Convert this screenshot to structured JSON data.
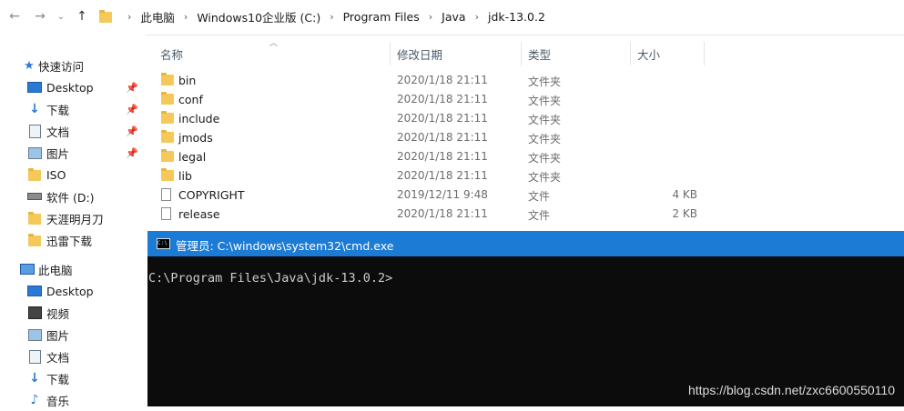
{
  "address": {
    "crumbs": [
      "此电脑",
      "Windows10企业版 (C:)",
      "Program Files",
      "Java",
      "jdk-13.0.2"
    ]
  },
  "sidebar": {
    "items": [
      {
        "label": "快速访问",
        "icon": "star-icon",
        "pinned": false
      },
      {
        "label": "Desktop",
        "icon": "desktop-icon",
        "pinned": true
      },
      {
        "label": "下载",
        "icon": "download-icon",
        "pinned": true
      },
      {
        "label": "文档",
        "icon": "document-icon",
        "pinned": true
      },
      {
        "label": "图片",
        "icon": "picture-icon",
        "pinned": true
      },
      {
        "label": "ISO",
        "icon": "folder-icon",
        "pinned": false
      },
      {
        "label": "软件 (D:)",
        "icon": "drive-icon",
        "pinned": false
      },
      {
        "label": "天涯明月刀",
        "icon": "folder-icon",
        "pinned": false
      },
      {
        "label": "迅雷下载",
        "icon": "folder-icon",
        "pinned": false
      },
      {
        "label": "此电脑",
        "icon": "computer-icon",
        "pinned": false
      },
      {
        "label": "Desktop",
        "icon": "desktop-icon",
        "pinned": false
      },
      {
        "label": "视频",
        "icon": "video-icon",
        "pinned": false
      },
      {
        "label": "图片",
        "icon": "picture-icon",
        "pinned": false
      },
      {
        "label": "文档",
        "icon": "document-icon",
        "pinned": false
      },
      {
        "label": "下载",
        "icon": "download-icon",
        "pinned": false
      },
      {
        "label": "音乐",
        "icon": "music-icon",
        "pinned": false
      }
    ]
  },
  "columns": {
    "name": "名称",
    "date": "修改日期",
    "type": "类型",
    "size": "大小"
  },
  "files": [
    {
      "name": "bin",
      "date": "2020/1/18 21:11",
      "type": "文件夹",
      "size": "",
      "kind": "folder"
    },
    {
      "name": "conf",
      "date": "2020/1/18 21:11",
      "type": "文件夹",
      "size": "",
      "kind": "folder"
    },
    {
      "name": "include",
      "date": "2020/1/18 21:11",
      "type": "文件夹",
      "size": "",
      "kind": "folder"
    },
    {
      "name": "jmods",
      "date": "2020/1/18 21:11",
      "type": "文件夹",
      "size": "",
      "kind": "folder"
    },
    {
      "name": "legal",
      "date": "2020/1/18 21:11",
      "type": "文件夹",
      "size": "",
      "kind": "folder"
    },
    {
      "name": "lib",
      "date": "2020/1/18 21:11",
      "type": "文件夹",
      "size": "",
      "kind": "folder"
    },
    {
      "name": "COPYRIGHT",
      "date": "2019/12/11 9:48",
      "type": "文件",
      "size": "4 KB",
      "kind": "file"
    },
    {
      "name": "release",
      "date": "2020/1/18 21:11",
      "type": "文件",
      "size": "2 KB",
      "kind": "file"
    }
  ],
  "cmd": {
    "title": "管理员: C:\\windows\\system32\\cmd.exe",
    "prompt": "C:\\Program Files\\Java\\jdk-13.0.2>"
  },
  "watermark": "https://blog.csdn.net/zxc6600550110",
  "colors": {
    "titlebar": "#1c7bd4",
    "console_bg": "#0c0c0c",
    "folder": "#f5c85a"
  }
}
